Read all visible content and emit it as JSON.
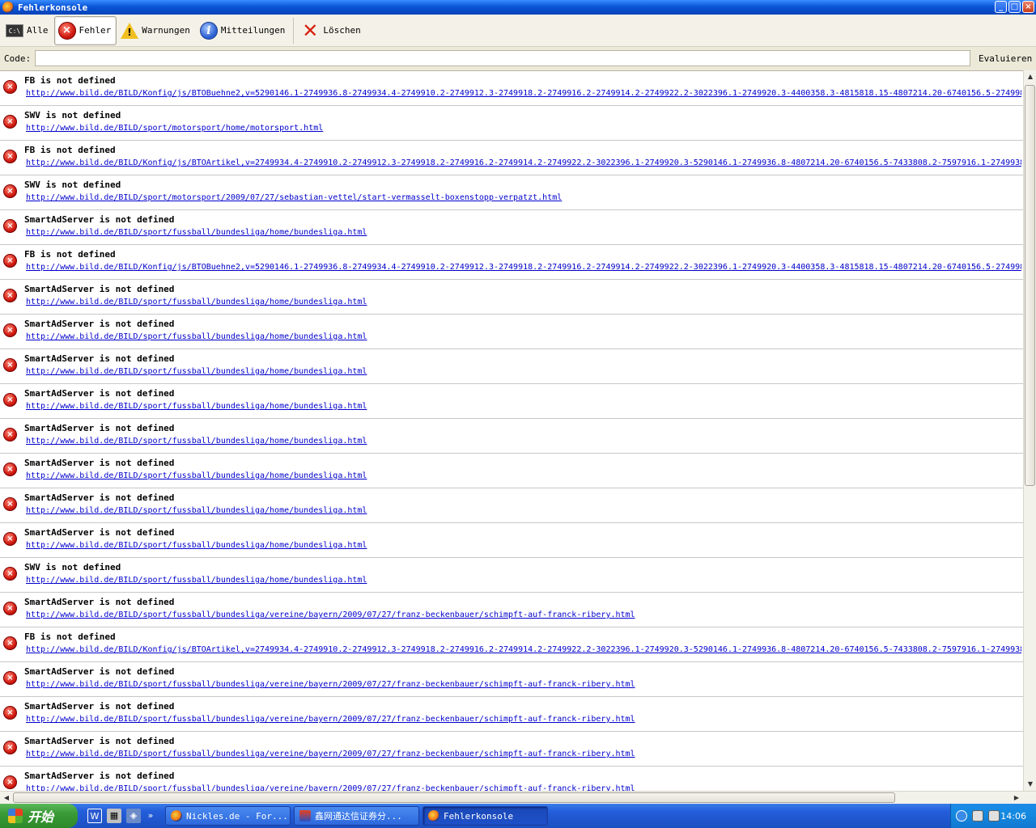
{
  "window": {
    "title": "Fehlerkonsole"
  },
  "toolbar": {
    "all_label": "Alle",
    "errors_label": "Fehler",
    "warnings_label": "Warnungen",
    "messages_label": "Mitteilungen",
    "clear_label": "Löschen",
    "active": "errors"
  },
  "codebar": {
    "label": "Code:",
    "value": "",
    "evaluate_label": "Evaluieren"
  },
  "messages": [
    {
      "text": "FB is not defined",
      "url": "http://www.bild.de/BILD/Konfig/js/BTOBuehne2,v=5290146.1-2749936.8-2749934.4-2749910.2-2749912.3-2749918.2-2749916.2-2749914.2-2749922.2-3022396.1-2749920.3-4400358.3-4815818.15-4807214.20-6740156.5-2749988"
    },
    {
      "text": "SWV is not defined",
      "url": "http://www.bild.de/BILD/sport/motorsport/home/motorsport.html"
    },
    {
      "text": "FB is not defined",
      "url": "http://www.bild.de/BILD/Konfig/js/BTOArtikel,v=2749934.4-2749910.2-2749912.3-2749918.2-2749916.2-2749914.2-2749922.2-3022396.1-2749920.3-5290146.1-2749936.8-4807214.20-6740156.5-7433808.2-7597916.1-2749938"
    },
    {
      "text": "SWV is not defined",
      "url": "http://www.bild.de/BILD/sport/motorsport/2009/07/27/sebastian-vettel/start-vermasselt-boxenstopp-verpatzt.html"
    },
    {
      "text": "SmartAdServer is not defined",
      "url": "http://www.bild.de/BILD/sport/fussball/bundesliga/home/bundesliga.html"
    },
    {
      "text": "FB is not defined",
      "url": "http://www.bild.de/BILD/Konfig/js/BTOBuehne2,v=5290146.1-2749936.8-2749934.4-2749910.2-2749912.3-2749918.2-2749916.2-2749914.2-2749922.2-3022396.1-2749920.3-4400358.3-4815818.15-4807214.20-6740156.5-2749988"
    },
    {
      "text": "SmartAdServer is not defined",
      "url": "http://www.bild.de/BILD/sport/fussball/bundesliga/home/bundesliga.html"
    },
    {
      "text": "SmartAdServer is not defined",
      "url": "http://www.bild.de/BILD/sport/fussball/bundesliga/home/bundesliga.html"
    },
    {
      "text": "SmartAdServer is not defined",
      "url": "http://www.bild.de/BILD/sport/fussball/bundesliga/home/bundesliga.html"
    },
    {
      "text": "SmartAdServer is not defined",
      "url": "http://www.bild.de/BILD/sport/fussball/bundesliga/home/bundesliga.html"
    },
    {
      "text": "SmartAdServer is not defined",
      "url": "http://www.bild.de/BILD/sport/fussball/bundesliga/home/bundesliga.html"
    },
    {
      "text": "SmartAdServer is not defined",
      "url": "http://www.bild.de/BILD/sport/fussball/bundesliga/home/bundesliga.html"
    },
    {
      "text": "SmartAdServer is not defined",
      "url": "http://www.bild.de/BILD/sport/fussball/bundesliga/home/bundesliga.html"
    },
    {
      "text": "SmartAdServer is not defined",
      "url": "http://www.bild.de/BILD/sport/fussball/bundesliga/home/bundesliga.html"
    },
    {
      "text": "SWV is not defined",
      "url": "http://www.bild.de/BILD/sport/fussball/bundesliga/home/bundesliga.html"
    },
    {
      "text": "SmartAdServer is not defined",
      "url": "http://www.bild.de/BILD/sport/fussball/bundesliga/vereine/bayern/2009/07/27/franz-beckenbauer/schimpft-auf-franck-ribery.html"
    },
    {
      "text": "FB is not defined",
      "url": "http://www.bild.de/BILD/Konfig/js/BTOArtikel,v=2749934.4-2749910.2-2749912.3-2749918.2-2749916.2-2749914.2-2749922.2-3022396.1-2749920.3-5290146.1-2749936.8-4807214.20-6740156.5-7433808.2-7597916.1-2749938"
    },
    {
      "text": "SmartAdServer is not defined",
      "url": "http://www.bild.de/BILD/sport/fussball/bundesliga/vereine/bayern/2009/07/27/franz-beckenbauer/schimpft-auf-franck-ribery.html"
    },
    {
      "text": "SmartAdServer is not defined",
      "url": "http://www.bild.de/BILD/sport/fussball/bundesliga/vereine/bayern/2009/07/27/franz-beckenbauer/schimpft-auf-franck-ribery.html"
    },
    {
      "text": "SmartAdServer is not defined",
      "url": "http://www.bild.de/BILD/sport/fussball/bundesliga/vereine/bayern/2009/07/27/franz-beckenbauer/schimpft-auf-franck-ribery.html"
    },
    {
      "text": "SmartAdServer is not defined",
      "url": "http://www.bild.de/BILD/sport/fussball/bundesliga/vereine/bayern/2009/07/27/franz-beckenbauer/schimpft-auf-franck-ribery.html"
    }
  ],
  "taskbar": {
    "start_label": "开始",
    "tasks": [
      {
        "label": "Nickles.de - For...",
        "icon": "firefox-icon",
        "active": false
      },
      {
        "label": "鑫网通达信证券分...",
        "icon": "stock-app-icon",
        "active": false
      },
      {
        "label": "Fehlerkonsole",
        "icon": "firefox-icon",
        "active": true
      }
    ],
    "clock": "14:06"
  },
  "colors": {
    "titlebar": "#0a56d8",
    "link": "#0000cc",
    "error": "#d01a10",
    "taskbar": "#245edb",
    "start": "#3a9a36"
  }
}
